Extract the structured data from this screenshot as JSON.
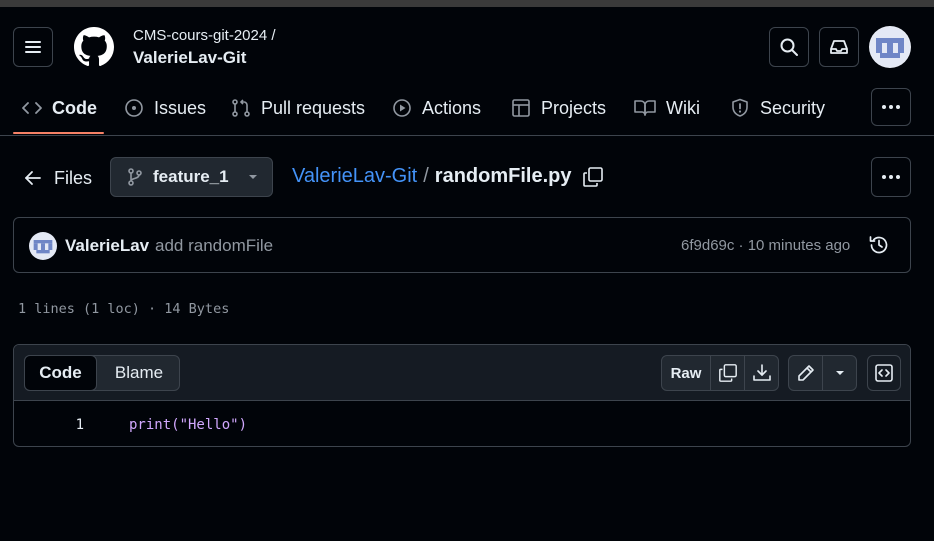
{
  "header": {
    "owner": "CMS-cours-git-2024 /",
    "repo": "ValerieLav-Git"
  },
  "nav": {
    "tabs": [
      {
        "label": "Code",
        "icon": "code-icon",
        "selected": true
      },
      {
        "label": "Issues",
        "icon": "issue-opened-icon"
      },
      {
        "label": "Pull requests",
        "icon": "git-pull-request-icon"
      },
      {
        "label": "Actions",
        "icon": "play-icon"
      },
      {
        "label": "Projects",
        "icon": "table-icon"
      },
      {
        "label": "Wiki",
        "icon": "book-icon"
      },
      {
        "label": "Security",
        "icon": "shield-icon"
      }
    ]
  },
  "filebar": {
    "files_label": "Files",
    "branch": "feature_1",
    "repo_link": "ValerieLav-Git",
    "separator": "/",
    "filename": "randomFile.py"
  },
  "commit": {
    "author": "ValerieLav",
    "message": "add randomFile",
    "sha_time": "6f9d69c · 10 minutes ago"
  },
  "file_info": "1 lines (1 loc) · 14 Bytes",
  "viewer": {
    "tabs": [
      "Code",
      "Blame"
    ],
    "raw_label": "Raw",
    "lines": [
      {
        "number": "1",
        "code": "print(\"Hello\")"
      }
    ]
  },
  "colors": {
    "background": "#010409",
    "accent_underline": "#f78166",
    "link": "#4493f8",
    "border": "#3d444d"
  }
}
